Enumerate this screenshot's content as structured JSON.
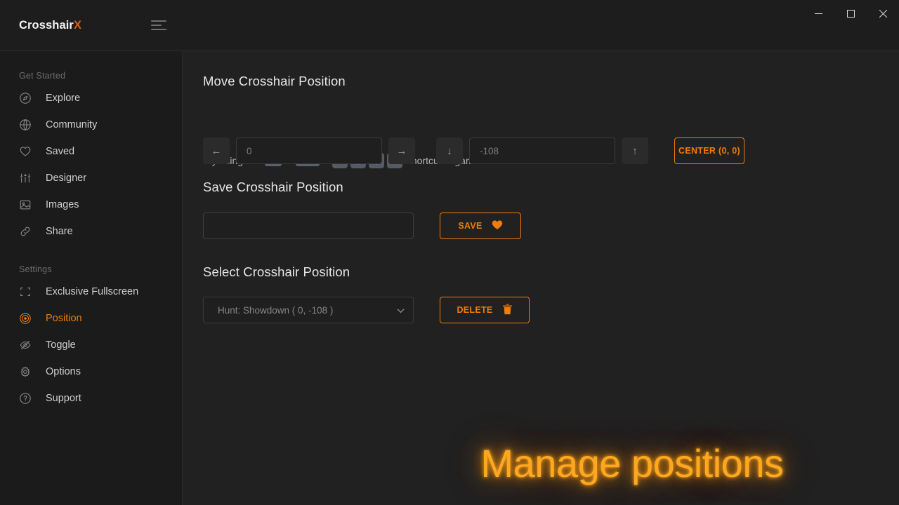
{
  "window": {
    "brand_name": "Crosshair",
    "brand_accent": "X",
    "menu_icon": "hamburger-icon",
    "minimize": "─",
    "maximize": "☐",
    "close": "✕"
  },
  "colors": {
    "accent": "#f07c0a",
    "accent_bright": "#ffa81f",
    "brand_x": "#e8590c",
    "sidebar_bg": "#1b1b1b",
    "main_bg": "#212121",
    "keycap_bg": "#5a616e"
  },
  "sidebar": {
    "groups": [
      {
        "title": "Get Started",
        "items": [
          {
            "label": "Explore",
            "icon": "compass-icon",
            "active": false
          },
          {
            "label": "Community",
            "icon": "globe-icon",
            "active": false
          },
          {
            "label": "Saved",
            "icon": "heart-icon",
            "active": false
          },
          {
            "label": "Designer",
            "icon": "sliders-icon",
            "active": false
          },
          {
            "label": "Images",
            "icon": "image-icon",
            "active": false
          },
          {
            "label": "Share",
            "icon": "link-icon",
            "active": false
          }
        ]
      },
      {
        "title": "Settings",
        "items": [
          {
            "label": "Exclusive Fullscreen",
            "icon": "fullscreen-icon",
            "active": false
          },
          {
            "label": "Position",
            "icon": "target-icon",
            "active": true
          },
          {
            "label": "Toggle",
            "icon": "eye-off-icon",
            "active": false
          },
          {
            "label": "Options",
            "icon": "gear-icon",
            "active": false
          },
          {
            "label": "Support",
            "icon": "question-circle-icon",
            "active": false
          }
        ]
      }
    ]
  },
  "main": {
    "move_section": {
      "title": "Move Crosshair Position",
      "hint_prefix": "Try using the ",
      "key_alt": "Alt",
      "key_shift": "Shift",
      "plus": "+",
      "arrow_left": "←",
      "arrow_up": "↑",
      "arrow_down": "↓",
      "arrow_right": "→",
      "hint_suffix": " shortcut in game",
      "x_value": "0",
      "y_value": "-108",
      "center_button": "CENTER (0, 0)"
    },
    "save_section": {
      "title": "Save Crosshair Position",
      "name_value": "",
      "name_placeholder": "",
      "save_button": "SAVE",
      "save_icon": "heart-filled-icon"
    },
    "select_section": {
      "title": "Select Crosshair Position",
      "selected_option": "Hunt: Showdown ( 0, -108 )",
      "options": [
        "Hunt: Showdown ( 0, -108 )"
      ],
      "delete_button": "DELETE",
      "delete_icon": "trash-icon"
    },
    "overlay_text": "Manage positions"
  }
}
